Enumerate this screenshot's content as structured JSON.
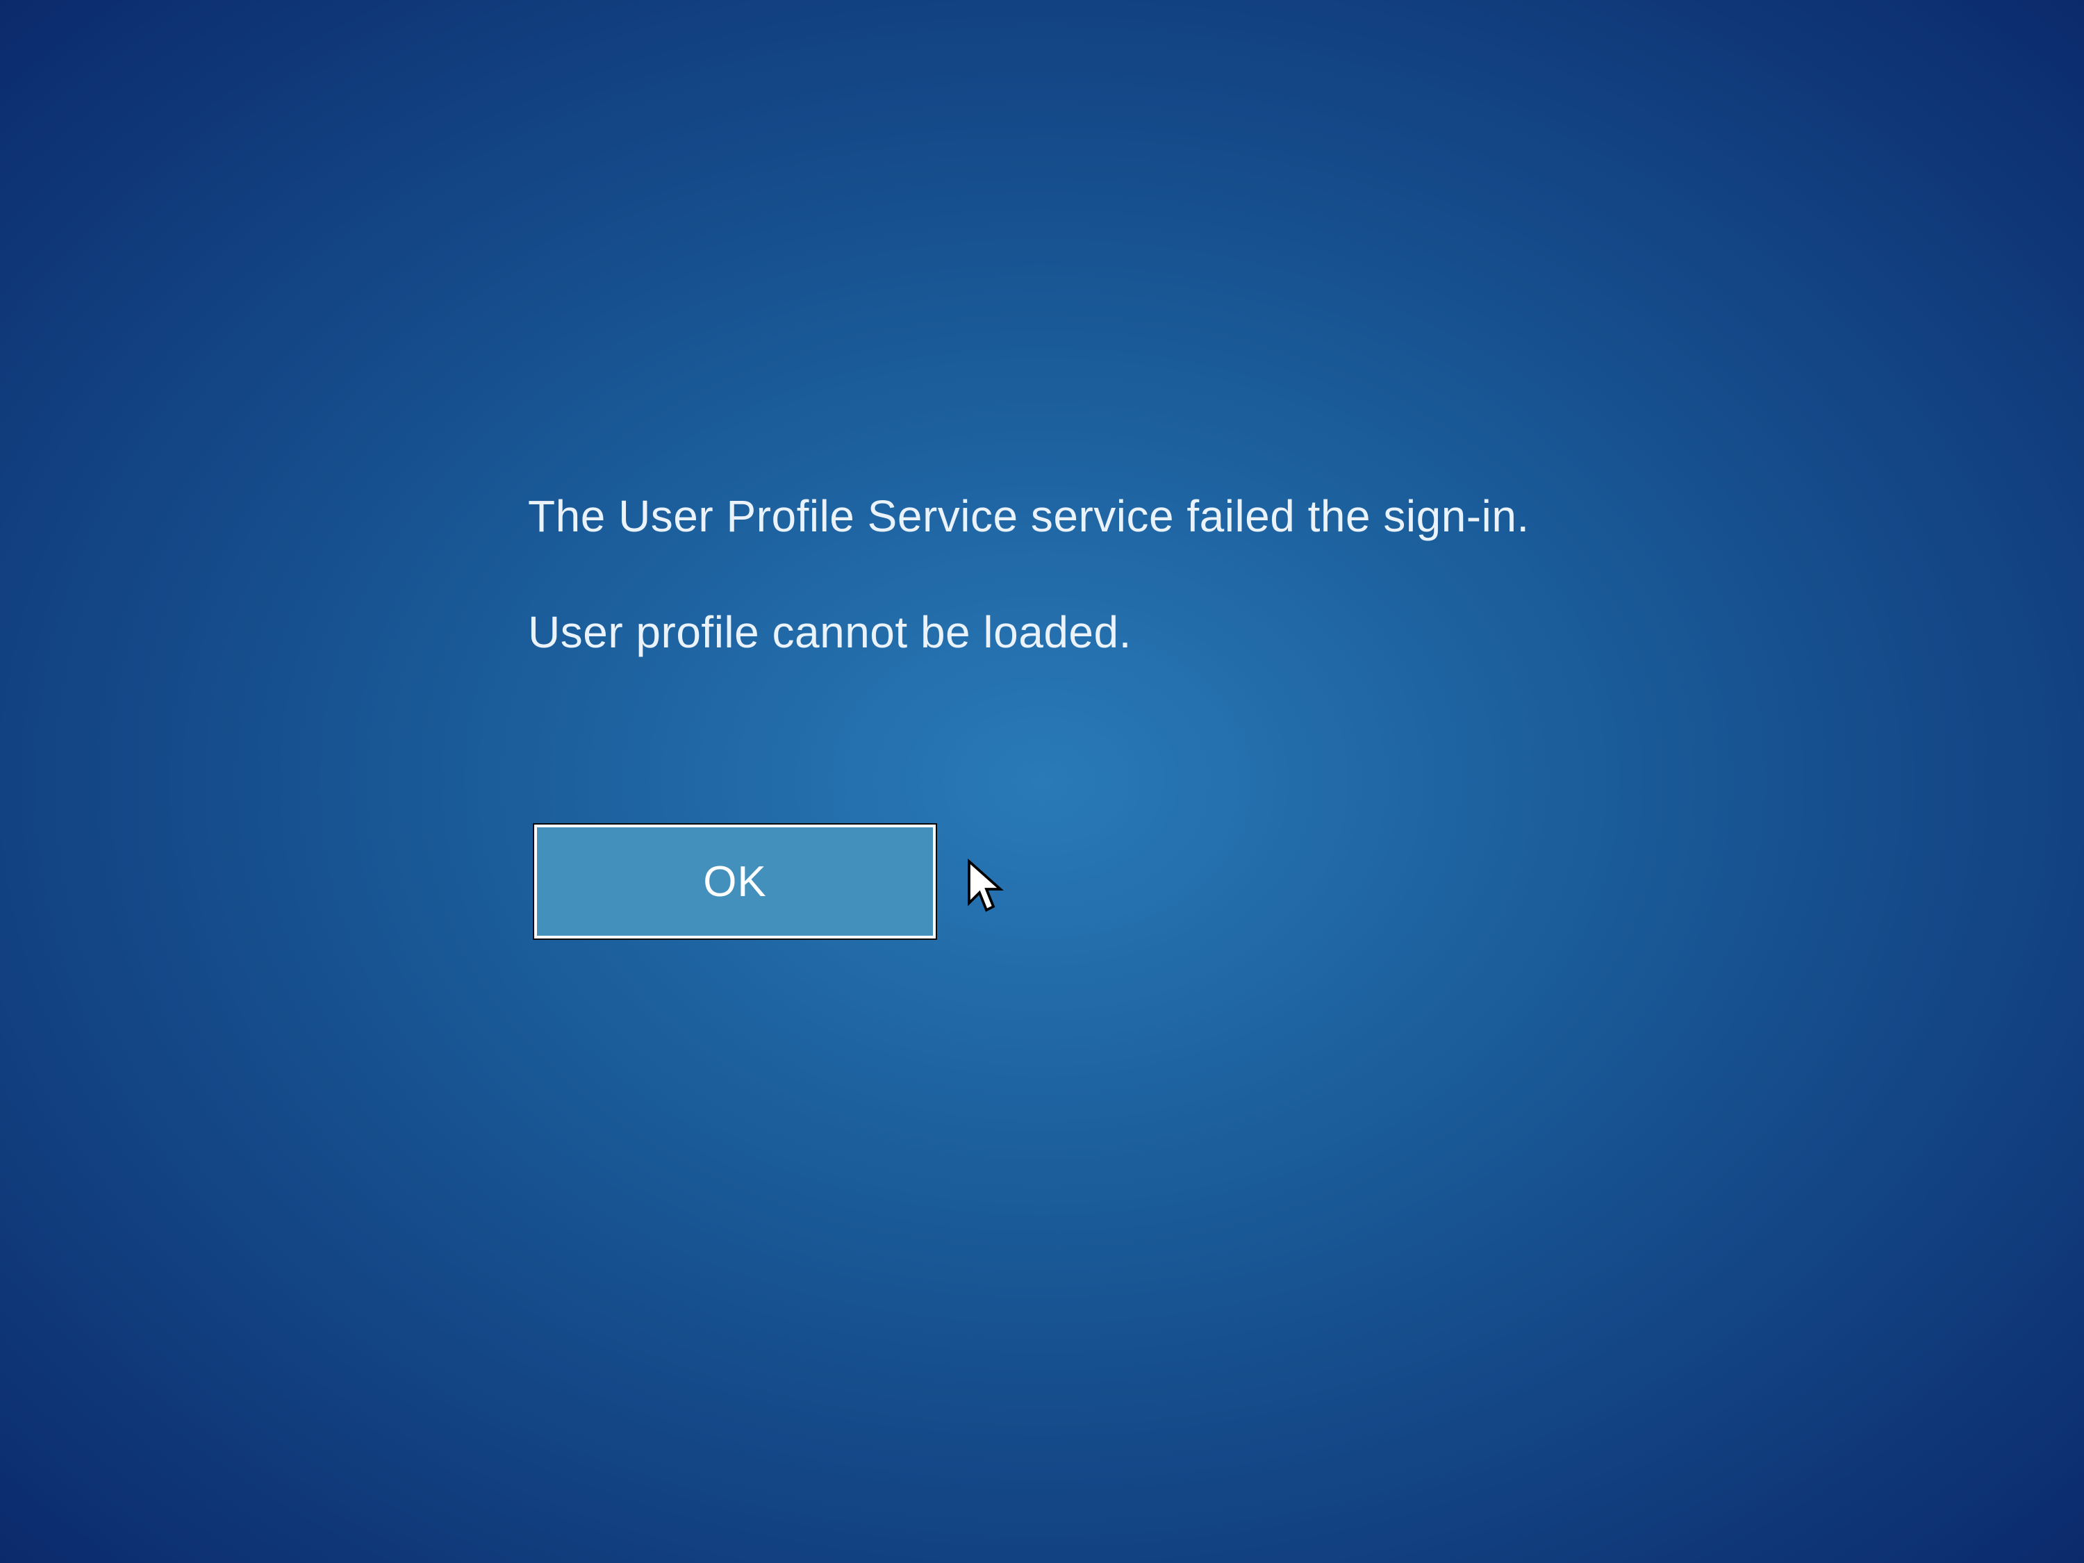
{
  "error": {
    "line1": "The User Profile Service service failed the sign-in.",
    "line2": "User profile cannot be loaded."
  },
  "button": {
    "ok_label": "OK"
  }
}
